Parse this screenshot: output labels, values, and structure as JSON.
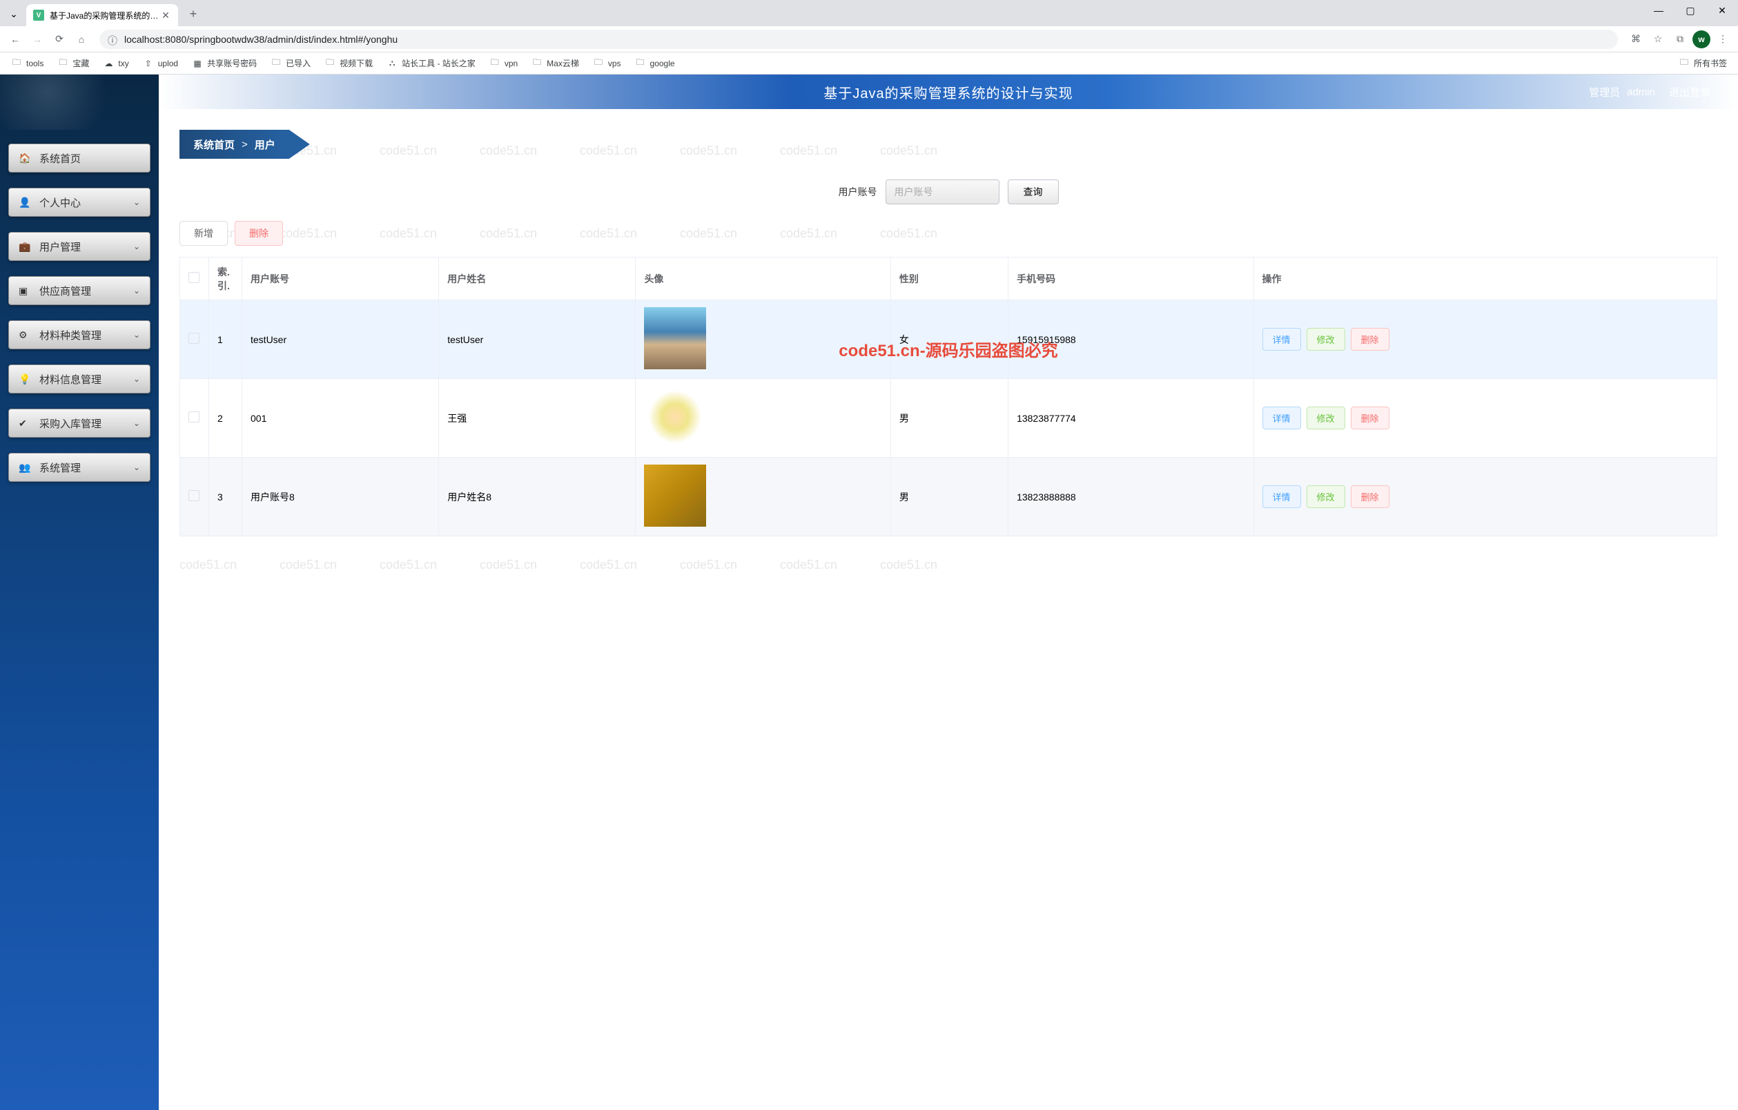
{
  "browser": {
    "tab_title": "基于Java的采购管理系统的设计",
    "url": "localhost:8080/springbootwdw38/admin/dist/index.html#/yonghu",
    "avatar_letter": "w",
    "bookmarks": [
      {
        "icon": "folder",
        "label": "tools"
      },
      {
        "icon": "folder",
        "label": "宝藏"
      },
      {
        "icon": "cloud",
        "label": "txy"
      },
      {
        "icon": "upload",
        "label": "uplod"
      },
      {
        "icon": "sheet",
        "label": "共享账号密码"
      },
      {
        "icon": "folder",
        "label": "已导入"
      },
      {
        "icon": "folder",
        "label": "视频下载"
      },
      {
        "icon": "station",
        "label": "站长工具 - 站长之家"
      },
      {
        "icon": "folder",
        "label": "vpn"
      },
      {
        "icon": "folder",
        "label": "Max云梯"
      },
      {
        "icon": "folder",
        "label": "vps"
      },
      {
        "icon": "folder",
        "label": "google"
      }
    ],
    "all_bookmarks": "所有书签"
  },
  "sidebar": {
    "items": [
      {
        "icon": "home",
        "label": "系统首页"
      },
      {
        "icon": "person",
        "label": "个人中心"
      },
      {
        "icon": "briefcase",
        "label": "用户管理"
      },
      {
        "icon": "supplier",
        "label": "供应商管理"
      },
      {
        "icon": "sliders",
        "label": "材料种类管理"
      },
      {
        "icon": "bulb",
        "label": "材料信息管理"
      },
      {
        "icon": "checkin",
        "label": "采购入库管理"
      },
      {
        "icon": "admin",
        "label": "系统管理"
      }
    ]
  },
  "header": {
    "title": "基于Java的采购管理系统的设计与实现",
    "role": "管理员",
    "user": "admin",
    "logout": "退出登录"
  },
  "breadcrumb": {
    "home": "系统首页",
    "sep": ">",
    "current": "用户"
  },
  "search": {
    "label": "用户账号",
    "placeholder": "用户账号",
    "button": "查询"
  },
  "actions": {
    "add": "新增",
    "delete": "删除"
  },
  "table": {
    "headers": {
      "checkbox": ".",
      "idx": "索.引.",
      "account": "用户账号",
      "name": "用户姓名",
      "avatar": "头像",
      "gender": "性别",
      "phone": "手机号码",
      "ops": "操作"
    },
    "rows": [
      {
        "idx": "1",
        "account": "testUser",
        "name": "testUser",
        "gender": "女",
        "phone": "15915915988",
        "avatarClass": "a1",
        "hovered": true
      },
      {
        "idx": "2",
        "account": "001",
        "name": "王强",
        "gender": "男",
        "phone": "13823877774",
        "avatarClass": "a2",
        "hovered": false
      },
      {
        "idx": "3",
        "account": "用户账号8",
        "name": "用户姓名8",
        "gender": "男",
        "phone": "13823888888",
        "avatarClass": "a3",
        "hovered": false
      }
    ],
    "op_labels": {
      "detail": "详情",
      "edit": "修改",
      "delete": "删除"
    }
  },
  "watermark": {
    "text": "code51.cn",
    "center": "code51.cn-源码乐园盗图必究"
  }
}
